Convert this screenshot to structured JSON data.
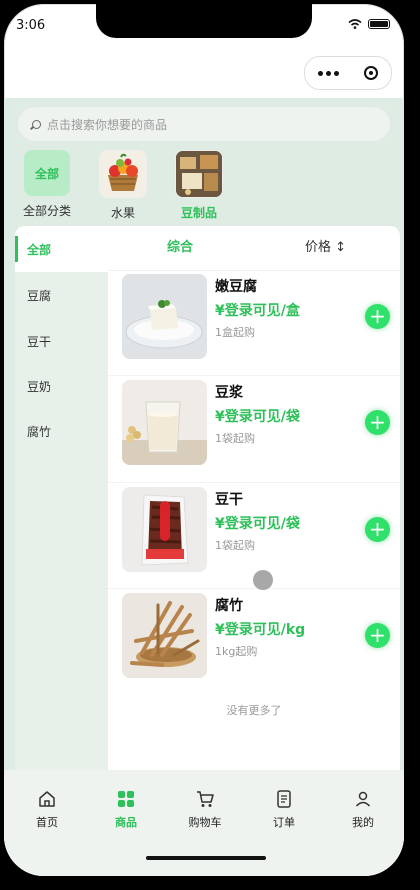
{
  "status": {
    "time": "3:06"
  },
  "search": {
    "placeholder": "点击搜索你想要的商品"
  },
  "categories": [
    {
      "label": "全部分类",
      "tile_text": "全部"
    },
    {
      "label": "水果"
    },
    {
      "label": "豆制品"
    }
  ],
  "sidebar": {
    "items": [
      {
        "label": "全部"
      },
      {
        "label": "豆腐"
      },
      {
        "label": "豆干"
      },
      {
        "label": "豆奶"
      },
      {
        "label": "腐竹"
      }
    ]
  },
  "sort": {
    "comprehensive": "综合",
    "price": "价格 ↕"
  },
  "products": [
    {
      "name": "嫩豆腐",
      "price": "¥登录可见/盒",
      "min": "1盒起购"
    },
    {
      "name": "豆浆",
      "price": "¥登录可见/袋",
      "min": "1袋起购"
    },
    {
      "name": "豆干",
      "price": "¥登录可见/袋",
      "min": "1袋起购"
    },
    {
      "name": "腐竹",
      "price": "¥登录可见/kg",
      "min": "1kg起购"
    }
  ],
  "no_more": "没有更多了",
  "tabbar": {
    "items": [
      {
        "label": "首页",
        "icon": "home-icon"
      },
      {
        "label": "商品",
        "icon": "grid-icon"
      },
      {
        "label": "购物车",
        "icon": "cart-icon"
      },
      {
        "label": "订单",
        "icon": "order-icon"
      },
      {
        "label": "我的",
        "icon": "user-icon"
      }
    ]
  },
  "colors": {
    "accent": "#2ec05a",
    "background": "#dfece3"
  }
}
